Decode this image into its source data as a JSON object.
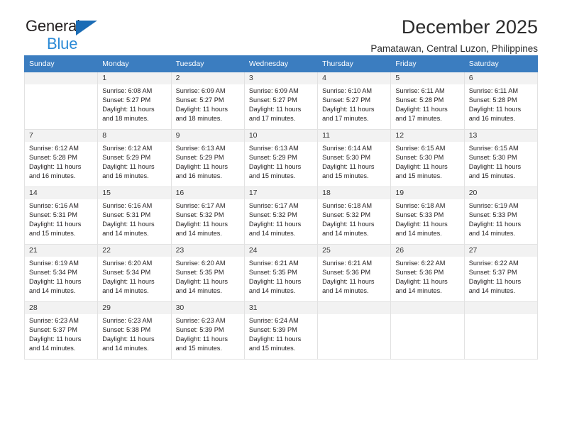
{
  "brand": {
    "word1": "General",
    "word2": "Blue",
    "accent_color": "#2b8ad6",
    "triangle_color": "#1b6cb5"
  },
  "header": {
    "title": "December 2025",
    "subtitle": "Pamatawan, Central Luzon, Philippines"
  },
  "table": {
    "header_bg": "#3b7dc0",
    "daynum_bg": "#f2f2f2",
    "weekdays": [
      "Sunday",
      "Monday",
      "Tuesday",
      "Wednesday",
      "Thursday",
      "Friday",
      "Saturday"
    ]
  },
  "labels": {
    "sunrise_prefix": "Sunrise: ",
    "sunset_prefix": "Sunset: ",
    "daylight_prefix": "Daylight: "
  },
  "weeks": [
    [
      {
        "day": "",
        "empty": true
      },
      {
        "day": "1",
        "sunrise": "Sunrise: 6:08 AM",
        "sunset": "Sunset: 5:27 PM",
        "daylight_a": "Daylight: 11 hours",
        "daylight_b": "and 18 minutes."
      },
      {
        "day": "2",
        "sunrise": "Sunrise: 6:09 AM",
        "sunset": "Sunset: 5:27 PM",
        "daylight_a": "Daylight: 11 hours",
        "daylight_b": "and 18 minutes."
      },
      {
        "day": "3",
        "sunrise": "Sunrise: 6:09 AM",
        "sunset": "Sunset: 5:27 PM",
        "daylight_a": "Daylight: 11 hours",
        "daylight_b": "and 17 minutes."
      },
      {
        "day": "4",
        "sunrise": "Sunrise: 6:10 AM",
        "sunset": "Sunset: 5:27 PM",
        "daylight_a": "Daylight: 11 hours",
        "daylight_b": "and 17 minutes."
      },
      {
        "day": "5",
        "sunrise": "Sunrise: 6:11 AM",
        "sunset": "Sunset: 5:28 PM",
        "daylight_a": "Daylight: 11 hours",
        "daylight_b": "and 17 minutes."
      },
      {
        "day": "6",
        "sunrise": "Sunrise: 6:11 AM",
        "sunset": "Sunset: 5:28 PM",
        "daylight_a": "Daylight: 11 hours",
        "daylight_b": "and 16 minutes."
      }
    ],
    [
      {
        "day": "7",
        "sunrise": "Sunrise: 6:12 AM",
        "sunset": "Sunset: 5:28 PM",
        "daylight_a": "Daylight: 11 hours",
        "daylight_b": "and 16 minutes."
      },
      {
        "day": "8",
        "sunrise": "Sunrise: 6:12 AM",
        "sunset": "Sunset: 5:29 PM",
        "daylight_a": "Daylight: 11 hours",
        "daylight_b": "and 16 minutes."
      },
      {
        "day": "9",
        "sunrise": "Sunrise: 6:13 AM",
        "sunset": "Sunset: 5:29 PM",
        "daylight_a": "Daylight: 11 hours",
        "daylight_b": "and 16 minutes."
      },
      {
        "day": "10",
        "sunrise": "Sunrise: 6:13 AM",
        "sunset": "Sunset: 5:29 PM",
        "daylight_a": "Daylight: 11 hours",
        "daylight_b": "and 15 minutes."
      },
      {
        "day": "11",
        "sunrise": "Sunrise: 6:14 AM",
        "sunset": "Sunset: 5:30 PM",
        "daylight_a": "Daylight: 11 hours",
        "daylight_b": "and 15 minutes."
      },
      {
        "day": "12",
        "sunrise": "Sunrise: 6:15 AM",
        "sunset": "Sunset: 5:30 PM",
        "daylight_a": "Daylight: 11 hours",
        "daylight_b": "and 15 minutes."
      },
      {
        "day": "13",
        "sunrise": "Sunrise: 6:15 AM",
        "sunset": "Sunset: 5:30 PM",
        "daylight_a": "Daylight: 11 hours",
        "daylight_b": "and 15 minutes."
      }
    ],
    [
      {
        "day": "14",
        "sunrise": "Sunrise: 6:16 AM",
        "sunset": "Sunset: 5:31 PM",
        "daylight_a": "Daylight: 11 hours",
        "daylight_b": "and 15 minutes."
      },
      {
        "day": "15",
        "sunrise": "Sunrise: 6:16 AM",
        "sunset": "Sunset: 5:31 PM",
        "daylight_a": "Daylight: 11 hours",
        "daylight_b": "and 14 minutes."
      },
      {
        "day": "16",
        "sunrise": "Sunrise: 6:17 AM",
        "sunset": "Sunset: 5:32 PM",
        "daylight_a": "Daylight: 11 hours",
        "daylight_b": "and 14 minutes."
      },
      {
        "day": "17",
        "sunrise": "Sunrise: 6:17 AM",
        "sunset": "Sunset: 5:32 PM",
        "daylight_a": "Daylight: 11 hours",
        "daylight_b": "and 14 minutes."
      },
      {
        "day": "18",
        "sunrise": "Sunrise: 6:18 AM",
        "sunset": "Sunset: 5:32 PM",
        "daylight_a": "Daylight: 11 hours",
        "daylight_b": "and 14 minutes."
      },
      {
        "day": "19",
        "sunrise": "Sunrise: 6:18 AM",
        "sunset": "Sunset: 5:33 PM",
        "daylight_a": "Daylight: 11 hours",
        "daylight_b": "and 14 minutes."
      },
      {
        "day": "20",
        "sunrise": "Sunrise: 6:19 AM",
        "sunset": "Sunset: 5:33 PM",
        "daylight_a": "Daylight: 11 hours",
        "daylight_b": "and 14 minutes."
      }
    ],
    [
      {
        "day": "21",
        "sunrise": "Sunrise: 6:19 AM",
        "sunset": "Sunset: 5:34 PM",
        "daylight_a": "Daylight: 11 hours",
        "daylight_b": "and 14 minutes."
      },
      {
        "day": "22",
        "sunrise": "Sunrise: 6:20 AM",
        "sunset": "Sunset: 5:34 PM",
        "daylight_a": "Daylight: 11 hours",
        "daylight_b": "and 14 minutes."
      },
      {
        "day": "23",
        "sunrise": "Sunrise: 6:20 AM",
        "sunset": "Sunset: 5:35 PM",
        "daylight_a": "Daylight: 11 hours",
        "daylight_b": "and 14 minutes."
      },
      {
        "day": "24",
        "sunrise": "Sunrise: 6:21 AM",
        "sunset": "Sunset: 5:35 PM",
        "daylight_a": "Daylight: 11 hours",
        "daylight_b": "and 14 minutes."
      },
      {
        "day": "25",
        "sunrise": "Sunrise: 6:21 AM",
        "sunset": "Sunset: 5:36 PM",
        "daylight_a": "Daylight: 11 hours",
        "daylight_b": "and 14 minutes."
      },
      {
        "day": "26",
        "sunrise": "Sunrise: 6:22 AM",
        "sunset": "Sunset: 5:36 PM",
        "daylight_a": "Daylight: 11 hours",
        "daylight_b": "and 14 minutes."
      },
      {
        "day": "27",
        "sunrise": "Sunrise: 6:22 AM",
        "sunset": "Sunset: 5:37 PM",
        "daylight_a": "Daylight: 11 hours",
        "daylight_b": "and 14 minutes."
      }
    ],
    [
      {
        "day": "28",
        "sunrise": "Sunrise: 6:23 AM",
        "sunset": "Sunset: 5:37 PM",
        "daylight_a": "Daylight: 11 hours",
        "daylight_b": "and 14 minutes."
      },
      {
        "day": "29",
        "sunrise": "Sunrise: 6:23 AM",
        "sunset": "Sunset: 5:38 PM",
        "daylight_a": "Daylight: 11 hours",
        "daylight_b": "and 14 minutes."
      },
      {
        "day": "30",
        "sunrise": "Sunrise: 6:23 AM",
        "sunset": "Sunset: 5:39 PM",
        "daylight_a": "Daylight: 11 hours",
        "daylight_b": "and 15 minutes."
      },
      {
        "day": "31",
        "sunrise": "Sunrise: 6:24 AM",
        "sunset": "Sunset: 5:39 PM",
        "daylight_a": "Daylight: 11 hours",
        "daylight_b": "and 15 minutes."
      },
      {
        "day": "",
        "empty": true
      },
      {
        "day": "",
        "empty": true
      },
      {
        "day": "",
        "empty": true
      }
    ]
  ]
}
